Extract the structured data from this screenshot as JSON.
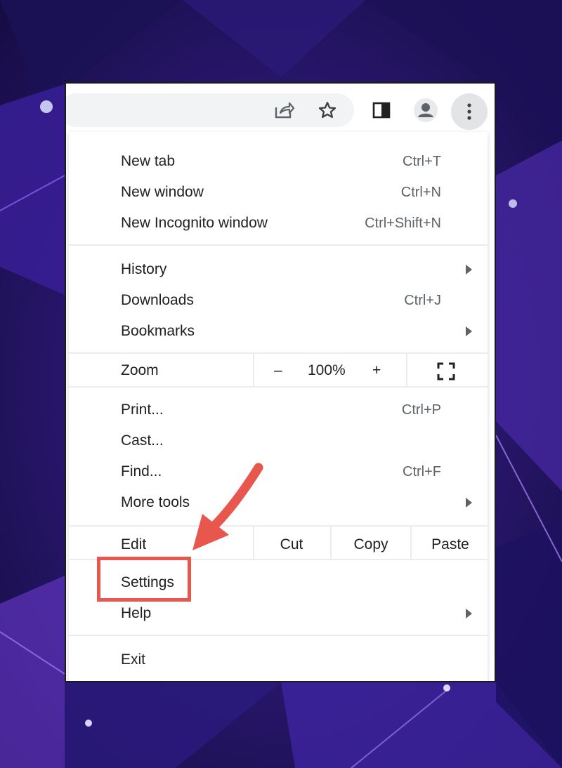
{
  "colors": {
    "background": "#24125a",
    "annotation": "#e8574e",
    "menu_text": "#202124",
    "shortcut_text": "#5f6368"
  },
  "toolbar": {
    "icons": [
      "share-icon",
      "star-icon",
      "side-panel-icon",
      "profile-icon",
      "kebab-menu-icon"
    ]
  },
  "menu": {
    "new_tab": {
      "label": "New tab",
      "shortcut": "Ctrl+T"
    },
    "new_window": {
      "label": "New window",
      "shortcut": "Ctrl+N"
    },
    "new_incognito": {
      "label": "New Incognito window",
      "shortcut": "Ctrl+Shift+N"
    },
    "history": {
      "label": "History"
    },
    "downloads": {
      "label": "Downloads",
      "shortcut": "Ctrl+J"
    },
    "bookmarks": {
      "label": "Bookmarks"
    },
    "zoom": {
      "label": "Zoom",
      "minus": "–",
      "value": "100%",
      "plus": "+"
    },
    "print": {
      "label": "Print...",
      "shortcut": "Ctrl+P"
    },
    "cast": {
      "label": "Cast..."
    },
    "find": {
      "label": "Find...",
      "shortcut": "Ctrl+F"
    },
    "more_tools": {
      "label": "More tools"
    },
    "edit": {
      "label": "Edit",
      "cut": "Cut",
      "copy": "Copy",
      "paste": "Paste"
    },
    "settings": {
      "label": "Settings"
    },
    "help": {
      "label": "Help"
    },
    "exit": {
      "label": "Exit"
    }
  }
}
